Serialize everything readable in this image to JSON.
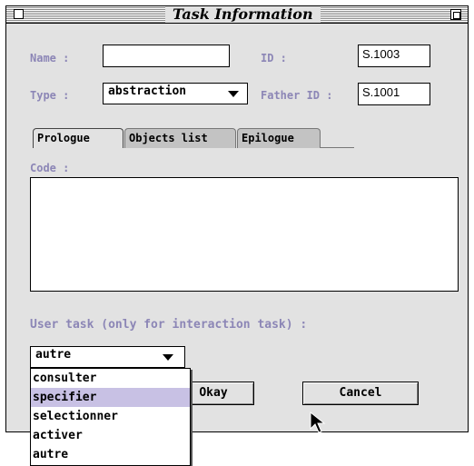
{
  "window": {
    "title": "Task Information"
  },
  "fields": {
    "name_label": "Name :",
    "name_value": "",
    "id_label": "ID :",
    "id_value": "S.1003",
    "type_label": "Type :",
    "type_value": "abstraction",
    "father_label": "Father ID :",
    "father_value": "S.1001"
  },
  "tabs": [
    {
      "label": "Prologue",
      "active": true
    },
    {
      "label": "Objects list",
      "active": false
    },
    {
      "label": "Epilogue",
      "active": false
    }
  ],
  "code": {
    "label": "Code :",
    "value": ""
  },
  "user_task": {
    "label": "User task (only for interaction task) :",
    "selected": "autre",
    "options": [
      "consulter",
      "specifier",
      "selectionner",
      "activer",
      "autre"
    ],
    "highlighted_index": 1
  },
  "buttons": {
    "okay": "Okay",
    "cancel": "Cancel"
  },
  "colors": {
    "label": "#8c86b6",
    "window_bg": "#e2e2e2",
    "menu_highlight": "#c8c1e4"
  }
}
